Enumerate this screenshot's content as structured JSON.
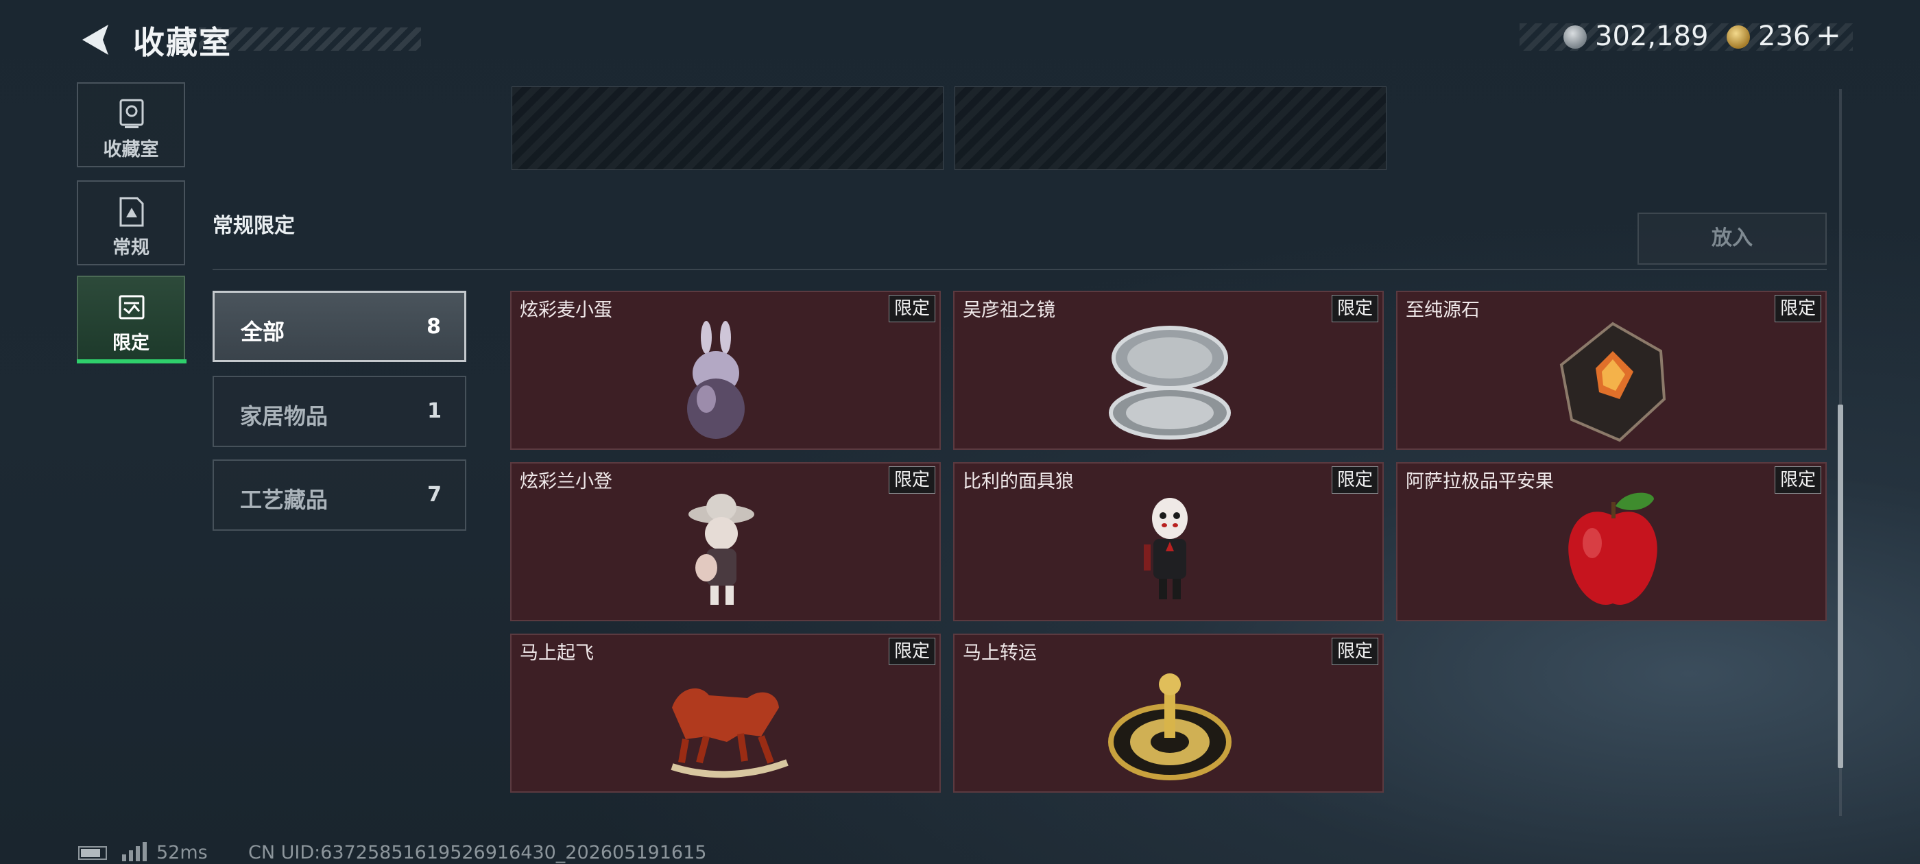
{
  "header": {
    "title": "收藏室",
    "back_icon": "back-arrow-icon"
  },
  "currency": {
    "silver": "302,189",
    "gold": "236",
    "plus": "+"
  },
  "sidebar": {
    "items": [
      {
        "label": "收藏室",
        "icon": "trophy-icon"
      },
      {
        "label": "常规",
        "icon": "document-icon"
      },
      {
        "label": "限定",
        "icon": "ticket-icon",
        "active": true
      }
    ]
  },
  "section": {
    "title": "常规限定",
    "put_button": "放入"
  },
  "filters": [
    {
      "label": "全部",
      "count": "8",
      "selected": true
    },
    {
      "label": "家居物品",
      "count": "1"
    },
    {
      "label": "工艺藏品",
      "count": "7"
    }
  ],
  "items": [
    {
      "name": "炫彩麦小蛋",
      "tag": "限定"
    },
    {
      "name": "吴彦祖之镜",
      "tag": "限定"
    },
    {
      "name": "至纯源石",
      "tag": "限定"
    },
    {
      "name": "炫彩兰小登",
      "tag": "限定"
    },
    {
      "name": "比利的面具狼",
      "tag": "限定"
    },
    {
      "name": "阿萨拉极品平安果",
      "tag": "限定"
    },
    {
      "name": "马上起飞",
      "tag": "限定"
    },
    {
      "name": "马上转运",
      "tag": "限定"
    }
  ],
  "footer": {
    "ping": "52ms",
    "uid": "CN UID:637258516195269164​30_202605191615"
  },
  "colors": {
    "card_bg": "#3d1f25",
    "active_tab_bar": "#2fd06c",
    "tag_bg": "#1a1a1c"
  }
}
